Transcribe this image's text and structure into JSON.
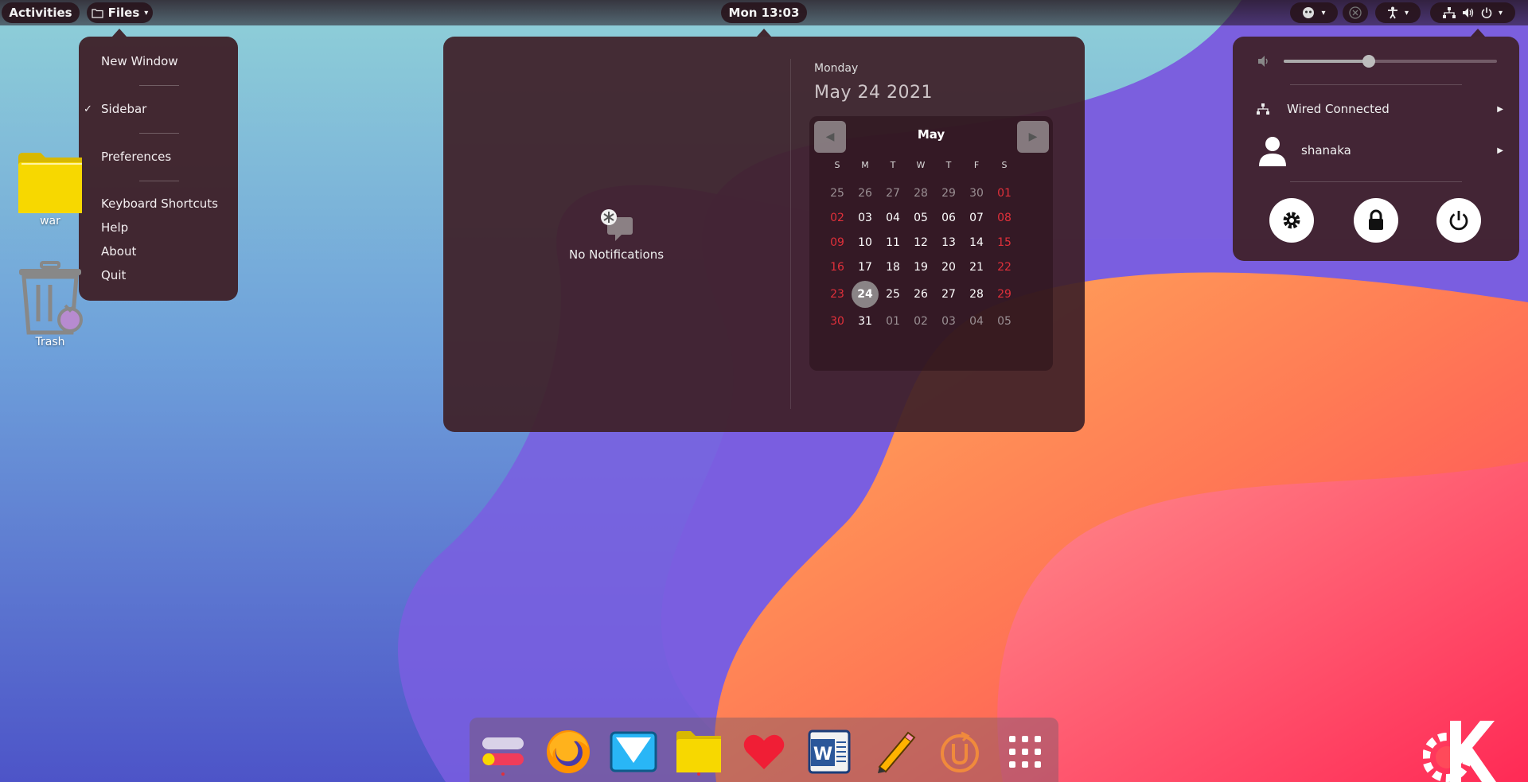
{
  "topbar": {
    "activities_label": "Activities",
    "app_menu_label": "Files",
    "clock_label": "Mon 13:03"
  },
  "files_menu": {
    "items": [
      {
        "label": "New Window"
      },
      {
        "label": "Sidebar",
        "checked": true
      },
      {
        "label": "Preferences"
      },
      {
        "label": "Keyboard Shortcuts"
      },
      {
        "label": "Help"
      },
      {
        "label": "About"
      },
      {
        "label": "Quit"
      }
    ]
  },
  "notifications": {
    "empty_text": "No Notifications"
  },
  "date_panel": {
    "weekday": "Monday",
    "date": "May 24 2021"
  },
  "calendar": {
    "month": "May",
    "weekday_headers": [
      "S",
      "M",
      "T",
      "W",
      "T",
      "F",
      "S"
    ],
    "weeks": [
      [
        "25",
        "26",
        "27",
        "28",
        "29",
        "30",
        "01"
      ],
      [
        "02",
        "03",
        "04",
        "05",
        "06",
        "07",
        "08"
      ],
      [
        "09",
        "10",
        "11",
        "12",
        "13",
        "14",
        "15"
      ],
      [
        "16",
        "17",
        "18",
        "19",
        "20",
        "21",
        "22"
      ],
      [
        "23",
        "24",
        "25",
        "26",
        "27",
        "28",
        "29"
      ],
      [
        "30",
        "31",
        "01",
        "02",
        "03",
        "04",
        "05"
      ]
    ],
    "today": "24",
    "weekend_color": "#e0303a",
    "today_color": "#8a8486"
  },
  "system_menu": {
    "volume_level": 0.4,
    "network_label": "Wired Connected",
    "user_label": "shanaka",
    "buttons": [
      "settings-icon",
      "lock-icon",
      "power-icon"
    ]
  },
  "desktop": {
    "icons": [
      {
        "label": "war",
        "icon": "folder-icon"
      },
      {
        "label": "Trash",
        "icon": "trash-icon"
      }
    ]
  },
  "dock": {
    "apps": [
      {
        "name": "toggle-app-icon",
        "running": true
      },
      {
        "name": "firefox-icon"
      },
      {
        "name": "mail-icon"
      },
      {
        "name": "files-icon",
        "running": true
      },
      {
        "name": "heart-icon"
      },
      {
        "name": "word-icon"
      },
      {
        "name": "pencil-icon"
      },
      {
        "name": "power-app-icon"
      },
      {
        "name": "app-grid-icon"
      }
    ]
  },
  "colors": {
    "panel_bg": "#3e2028",
    "accent_red": "#e0303a",
    "folder_yellow": "#f7d800"
  }
}
